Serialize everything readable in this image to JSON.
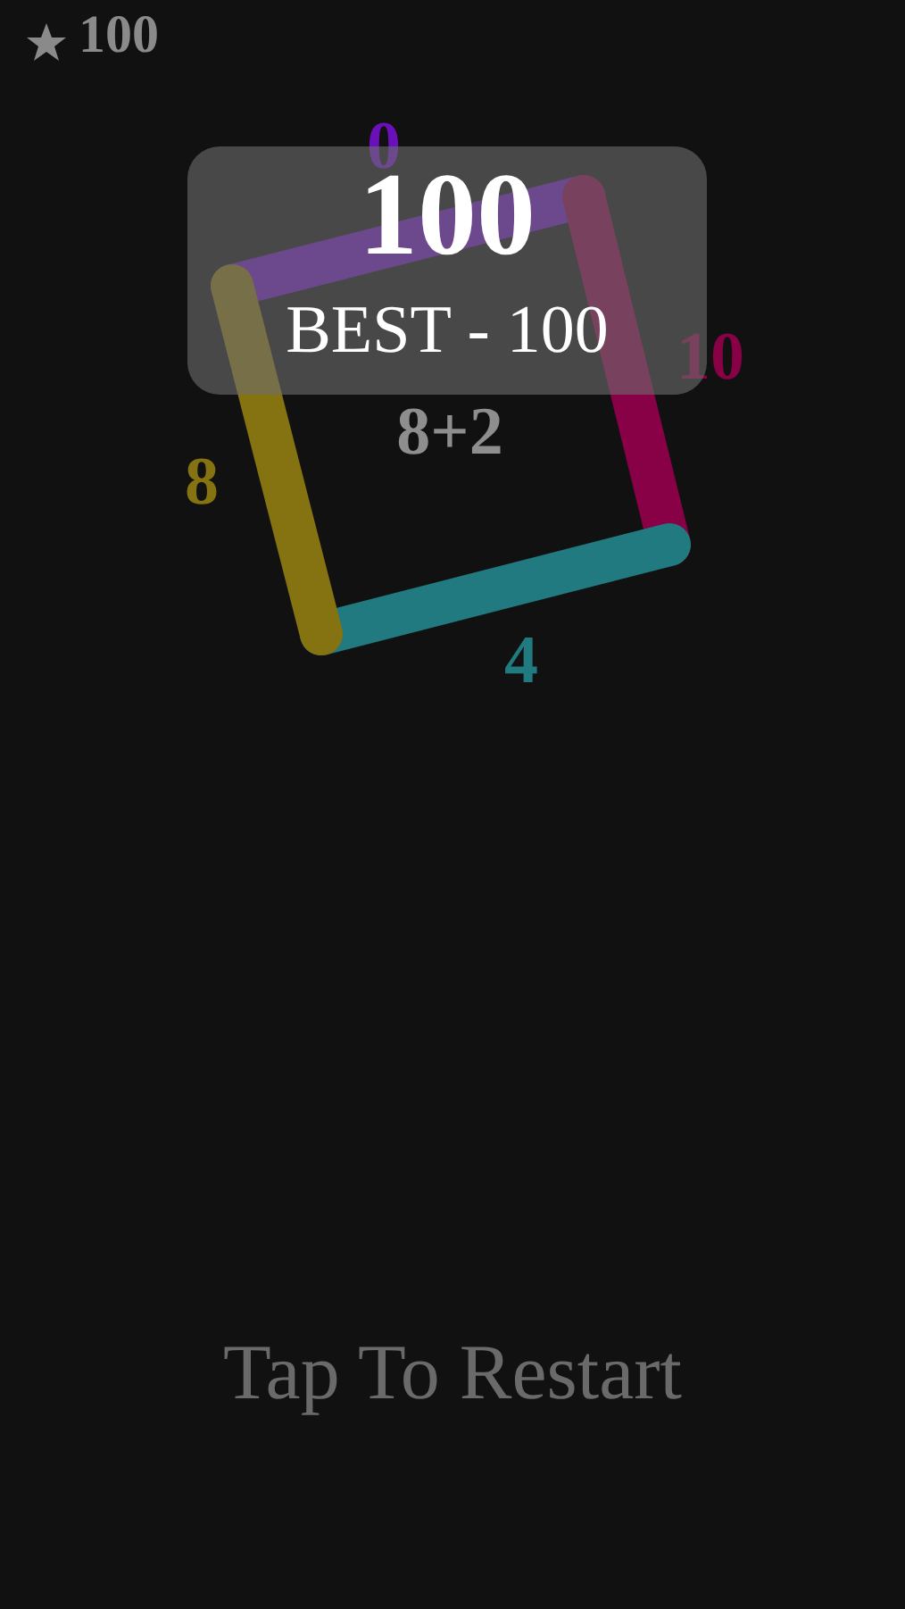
{
  "hud": {
    "score": "100"
  },
  "board": {
    "sides": [
      {
        "label": "0",
        "color": "#6a10b8"
      },
      {
        "label": "10",
        "color": "#880046"
      },
      {
        "label": "4",
        "color": "#217a80"
      },
      {
        "label": "8",
        "color": "#857210"
      }
    ],
    "equation": "8+2"
  },
  "result": {
    "score": "100",
    "best": "BEST - 100"
  },
  "prompt": "Tap To Restart"
}
